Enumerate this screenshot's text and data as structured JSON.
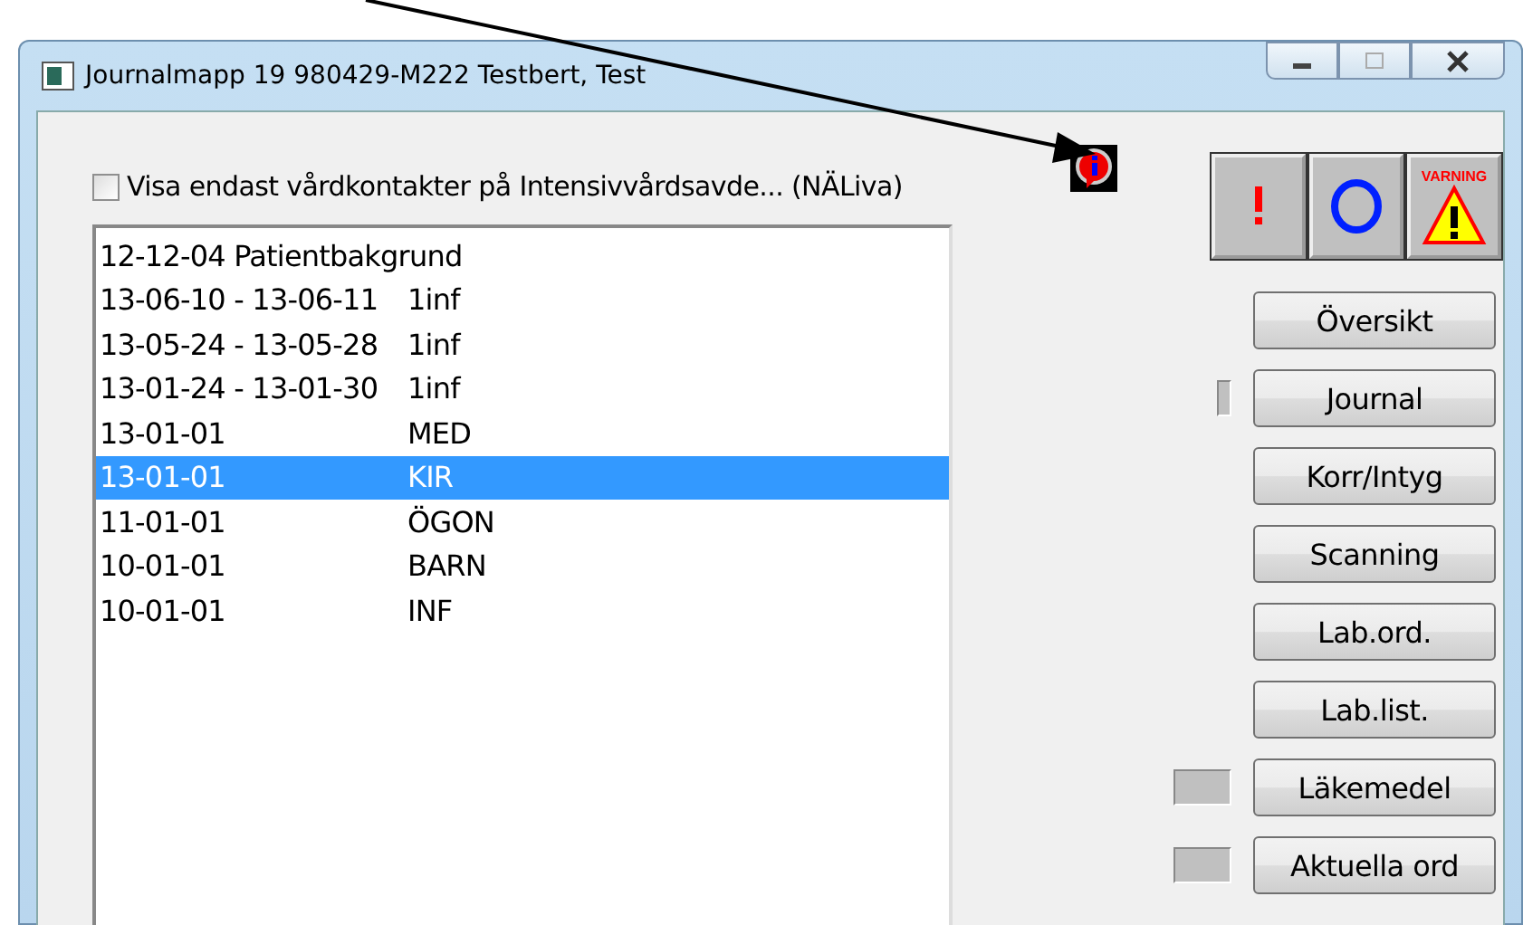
{
  "window": {
    "title": "Journalmapp 19 980429-M222  Testbert, Test"
  },
  "filter": {
    "label": "Visa endast vårdkontakter på Intensivvårdsavde... (NÄLiva)",
    "checked": false
  },
  "alert_buttons": [
    {
      "kind": "exclamation"
    },
    {
      "kind": "circle"
    },
    {
      "kind": "warning",
      "label": "VARNING"
    }
  ],
  "contacts": [
    {
      "date": "12-12-04 Patientbakgrund",
      "selected": false
    },
    {
      "date": "13-06-10 - 13-06-11",
      "unit": "1inf",
      "selected": false
    },
    {
      "date": "13-05-24 - 13-05-28",
      "unit": "1inf",
      "selected": false
    },
    {
      "date": "13-01-24 - 13-01-30",
      "unit": "1inf",
      "selected": false
    },
    {
      "date": "13-01-01",
      "unit": "MED",
      "selected": false
    },
    {
      "date": "13-01-01",
      "unit": "KIR",
      "selected": true
    },
    {
      "date": "11-01-01",
      "unit": "ÖGON",
      "selected": false
    },
    {
      "date": "10-01-01",
      "unit": "BARN",
      "selected": false
    },
    {
      "date": "10-01-01",
      "unit": "INF",
      "selected": false
    }
  ],
  "buttons": [
    {
      "label": "Översikt",
      "kind": "plain"
    },
    {
      "label": "Journal",
      "kind": "narrow"
    },
    {
      "label": "Korr/Intyg",
      "kind": "plain"
    },
    {
      "label": "Scanning",
      "kind": "plain"
    },
    {
      "label": "Lab.ord.",
      "kind": "plain"
    },
    {
      "label": "Lab.list.",
      "kind": "plain"
    },
    {
      "label": "Läkemedel",
      "kind": "wide"
    },
    {
      "label": "Aktuella ord",
      "kind": "wide"
    }
  ]
}
